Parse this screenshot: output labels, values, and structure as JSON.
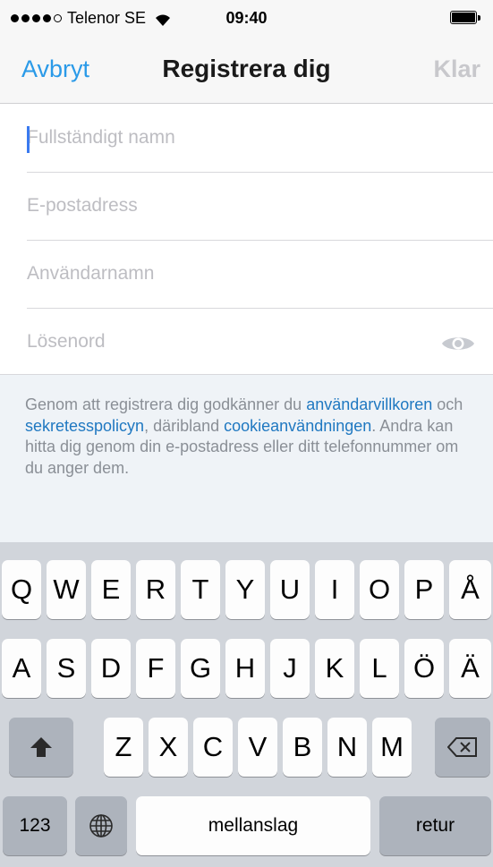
{
  "status_bar": {
    "carrier": "Telenor SE",
    "time": "09:40",
    "signal_bars_filled": 4,
    "signal_bars_total": 5,
    "wifi_icon": "wifi-icon",
    "battery_icon": "battery-icon"
  },
  "nav": {
    "cancel_label": "Avbryt",
    "title": "Registrera dig",
    "done_label": "Klar"
  },
  "form": {
    "full_name_placeholder": "Fullständigt namn",
    "full_name_value": "",
    "email_placeholder": "E-postadress",
    "email_value": "",
    "username_placeholder": "Användarnamn",
    "username_value": "",
    "password_placeholder": "Lösenord",
    "password_value": "",
    "show_password_icon": "eye-icon"
  },
  "terms": {
    "part1": "Genom att registrera dig godkänner du ",
    "link_terms": "användarvillkoren",
    "part2": " och ",
    "link_privacy": "sekretesspolicyn",
    "part3": ", däribland ",
    "link_cookies": "cookieanvändningen",
    "part4": ". Andra kan hitta dig genom din e-postadress eller ditt telefonnummer om du anger dem."
  },
  "keyboard": {
    "row1": [
      "Q",
      "W",
      "E",
      "R",
      "T",
      "Y",
      "U",
      "I",
      "O",
      "P",
      "Å"
    ],
    "row2": [
      "A",
      "S",
      "D",
      "F",
      "G",
      "H",
      "J",
      "K",
      "L",
      "Ö",
      "Ä"
    ],
    "row3": [
      "Z",
      "X",
      "C",
      "V",
      "B",
      "N",
      "M"
    ],
    "shift_icon": "shift-icon",
    "backspace_icon": "backspace-icon",
    "numbers_label": "123",
    "globe_icon": "globe-icon",
    "space_label": "mellanslag",
    "return_label": "retur"
  },
  "colors": {
    "accent": "#2a9ae8",
    "link": "#1f78c1",
    "caret": "#3a7af0",
    "done_disabled": "#c8c8cc"
  }
}
